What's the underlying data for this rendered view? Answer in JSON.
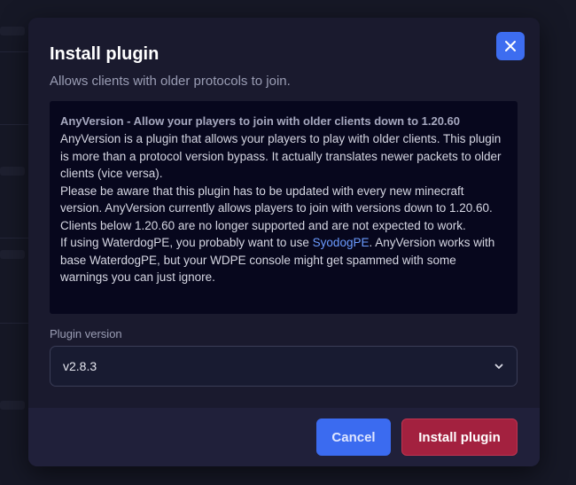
{
  "modal": {
    "title": "Install plugin",
    "subtitle": "Allows clients with older protocols to join.",
    "close_icon": "close-icon"
  },
  "description": {
    "heading": "AnyVersion - Allow your players to join with older clients down to 1.20.60",
    "paragraph1": "AnyVersion is a plugin that allows your players to play with older clients. This plugin is more than a protocol version bypass. It actually translates newer packets to older clients (vice versa).",
    "paragraph2": "Please be aware that this plugin has to be updated with every new minecraft version. AnyVersion currently allows players to join with versions down to 1.20.60. Clients below 1.20.60 are no longer supported and are not expected to work.",
    "paragraph3_before": "If using WaterdogPE, you probably want to use ",
    "paragraph3_link": "SyodogPE",
    "paragraph3_after": ". AnyVersion works with base WaterdogPE, but your WDPE console might get spammed with some warnings you can just ignore."
  },
  "version_field": {
    "label": "Plugin version",
    "selected": "v2.8.3",
    "chevron_icon": "chevron-down-icon"
  },
  "footer": {
    "cancel_label": "Cancel",
    "install_label": "Install plugin"
  },
  "colors": {
    "accent_blue": "#3d6df0",
    "install_red": "#a3213f",
    "link": "#6b9bff"
  }
}
